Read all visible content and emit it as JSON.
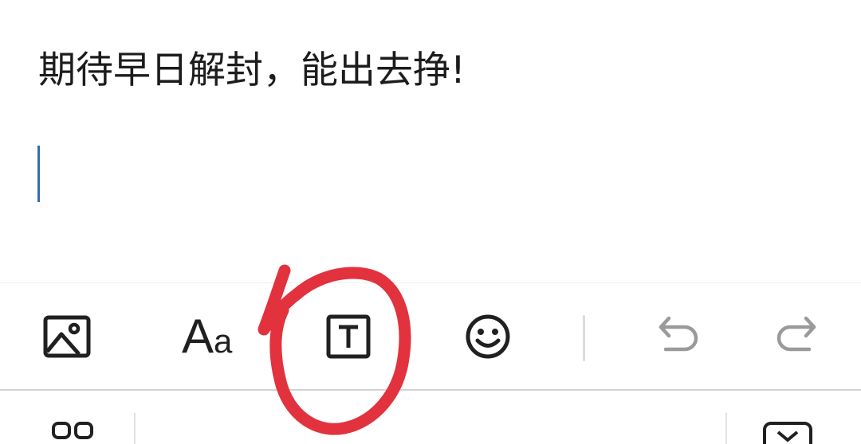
{
  "editor": {
    "text": "期待早日解封，能出去挣!"
  },
  "toolbar": {
    "font_label_big": "A",
    "font_label_small": "a",
    "items": [
      {
        "icon": "image-icon",
        "action": "insert-image"
      },
      {
        "icon": "font-icon",
        "action": "font-style"
      },
      {
        "icon": "text-box-icon",
        "action": "text-box"
      },
      {
        "icon": "emoji-icon",
        "action": "emoji"
      },
      {
        "icon": "undo-icon",
        "action": "undo"
      },
      {
        "icon": "redo-icon",
        "action": "redo"
      }
    ]
  },
  "keyboard_bar": {
    "left_icon": "keyboard-layout-icon",
    "right_icon": "keyboard-dismiss-icon"
  },
  "annotation": {
    "shape": "hand-drawn circle",
    "color": "#e2323e",
    "target": "text-box-button"
  },
  "colors": {
    "caret": "#2f6fb3",
    "icon": "#202020",
    "icon_disabled": "#9a9a9a",
    "annotation": "#e2323e"
  }
}
